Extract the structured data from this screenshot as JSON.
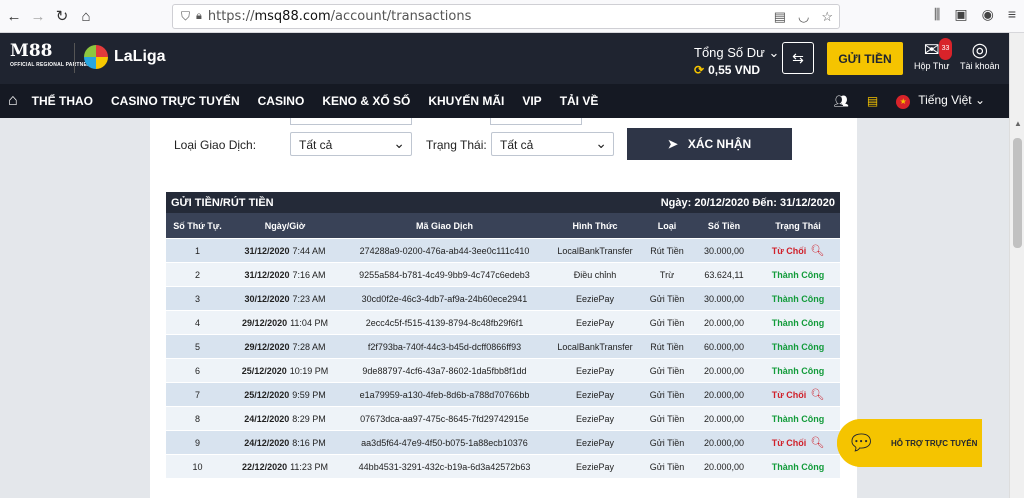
{
  "browser": {
    "url_prefix": "https://",
    "url_domain": "msq88.com",
    "url_path": "/account/transactions"
  },
  "header": {
    "logo_text": "M88",
    "logo_sub": "OFFICIAL REGIONAL PARTNER",
    "partner": "LaLiga",
    "balance_label": "Tổng Số Dư",
    "balance_value": "0,55 VND",
    "deposit_label": "GỬI TIỀN",
    "mail_label": "Hộp Thư",
    "mail_badge": "33",
    "account_label": "Tài khoản"
  },
  "nav": {
    "items": [
      "THỂ THAO",
      "CASINO TRỰC TUYẾN",
      "CASINO",
      "KENO & XỔ SỐ",
      "KHUYẾN MÃI",
      "VIP",
      "TẢI VỀ"
    ],
    "language": "Tiếng Việt"
  },
  "filters": {
    "type_label": "Loại Giao Dịch:",
    "type_value": "Tất cả",
    "status_label": "Trạng Thái:",
    "status_value": "Tất cả",
    "confirm_label": "XÁC NHẬN"
  },
  "table": {
    "title": "GỬI TIỀN/RÚT TIỀN",
    "date_range": "Ngày: 20/12/2020 Đến: 31/12/2020",
    "columns": [
      "Số Thứ Tự.",
      "Ngày/Giờ",
      "Mã Giao Dịch",
      "Hình Thức",
      "Loại",
      "Số Tiền",
      "Trạng Thái"
    ],
    "rows": [
      {
        "no": "1",
        "date": "31/12/2020",
        "time": "7:44 AM",
        "id": "274288a9-0200-476a-ab44-3ee0c111c410",
        "method": "LocalBankTransfer",
        "type": "Rút Tiền",
        "amount": "30.000,00",
        "status": "Từ Chối",
        "ok": false
      },
      {
        "no": "2",
        "date": "31/12/2020",
        "time": "7:16 AM",
        "id": "9255a584-b781-4c49-9bb9-4c747c6edeb3",
        "method": "Điều chỉnh",
        "type": "Trừ",
        "amount": "63.624,11",
        "status": "Thành Công",
        "ok": true
      },
      {
        "no": "3",
        "date": "30/12/2020",
        "time": "7:23 AM",
        "id": "30cd0f2e-46c3-4db7-af9a-24b60ece2941",
        "method": "EeziePay",
        "type": "Gửi Tiền",
        "amount": "30.000,00",
        "status": "Thành Công",
        "ok": true
      },
      {
        "no": "4",
        "date": "29/12/2020",
        "time": "11:04 PM",
        "id": "2ecc4c5f-f515-4139-8794-8c48fb29f6f1",
        "method": "EeziePay",
        "type": "Gửi Tiền",
        "amount": "20.000,00",
        "status": "Thành Công",
        "ok": true
      },
      {
        "no": "5",
        "date": "29/12/2020",
        "time": "7:28 AM",
        "id": "f2f793ba-740f-44c3-b45d-dcff0866ff93",
        "method": "LocalBankTransfer",
        "type": "Rút Tiền",
        "amount": "60.000,00",
        "status": "Thành Công",
        "ok": true
      },
      {
        "no": "6",
        "date": "25/12/2020",
        "time": "10:19 PM",
        "id": "9de88797-4cf6-43a7-8602-1da5fbb8f1dd",
        "method": "EeziePay",
        "type": "Gửi Tiền",
        "amount": "20.000,00",
        "status": "Thành Công",
        "ok": true
      },
      {
        "no": "7",
        "date": "25/12/2020",
        "time": "9:59 PM",
        "id": "e1a79959-a130-4feb-8d6b-a788d70766bb",
        "method": "EeziePay",
        "type": "Gửi Tiền",
        "amount": "20.000,00",
        "status": "Từ Chối",
        "ok": false
      },
      {
        "no": "8",
        "date": "24/12/2020",
        "time": "8:29 PM",
        "id": "07673dca-aa97-475c-8645-7fd29742915e",
        "method": "EeziePay",
        "type": "Gửi Tiền",
        "amount": "20.000,00",
        "status": "Thành Công",
        "ok": true
      },
      {
        "no": "9",
        "date": "24/12/2020",
        "time": "8:16 PM",
        "id": "aa3d5f64-47e9-4f50-b075-1a88ecb10376",
        "method": "EeziePay",
        "type": "Gửi Tiền",
        "amount": "20.000,00",
        "status": "Từ Chối",
        "ok": false
      },
      {
        "no": "10",
        "date": "22/12/2020",
        "time": "11:23 PM",
        "id": "44bb4531-3291-432c-b19a-6d3a42572b63",
        "method": "EeziePay",
        "type": "Gửi Tiền",
        "amount": "20.000,00",
        "status": "Thành Công",
        "ok": true
      }
    ]
  },
  "chat": {
    "label": "HỖ TRỢ TRỰC TUYẾN"
  },
  "colors": {
    "accent": "#f5c400",
    "header_bg": "#1f2430",
    "success": "#129b3a",
    "error": "#d0202a"
  }
}
